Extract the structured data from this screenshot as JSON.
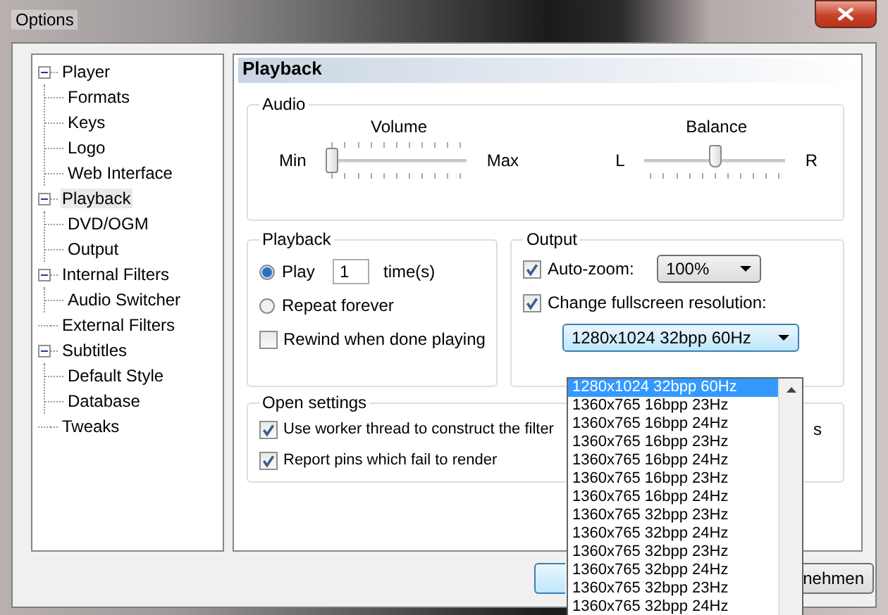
{
  "window": {
    "title": "Options"
  },
  "tree": [
    {
      "label": "Player",
      "selected": false,
      "expanded": true,
      "children": [
        {
          "label": "Formats",
          "selected": false
        },
        {
          "label": "Keys",
          "selected": false
        },
        {
          "label": "Logo",
          "selected": false
        },
        {
          "label": "Web Interface",
          "selected": false
        }
      ]
    },
    {
      "label": "Playback",
      "selected": true,
      "expanded": true,
      "children": [
        {
          "label": "DVD/OGM",
          "selected": false
        },
        {
          "label": "Output",
          "selected": false
        }
      ]
    },
    {
      "label": "Internal Filters",
      "selected": false,
      "expanded": true,
      "children": [
        {
          "label": "Audio Switcher",
          "selected": false
        }
      ]
    },
    {
      "label": "External Filters",
      "selected": false
    },
    {
      "label": "Subtitles",
      "selected": false,
      "expanded": true,
      "children": [
        {
          "label": "Default Style",
          "selected": false
        },
        {
          "label": "Database",
          "selected": false
        }
      ]
    },
    {
      "label": "Tweaks",
      "selected": false
    }
  ],
  "page_title": "Playback",
  "audio": {
    "title": "Audio",
    "sliders": [
      {
        "title": "Volume",
        "min_label": "Min",
        "max_label": "Max",
        "level": 0,
        "ticks_top": true
      },
      {
        "title": "Balance",
        "min_label": "L",
        "max_label": "R",
        "level": 0.5,
        "ticks_top": false
      }
    ]
  },
  "playback": {
    "title": "Playback",
    "radios": [
      {
        "label": "Play",
        "selected": true,
        "count": "1",
        "unit": "time(s)"
      },
      {
        "label": "Repeat forever",
        "selected": false
      }
    ],
    "rewind": {
      "label": "Rewind when done playing",
      "checked": false
    }
  },
  "output": {
    "title": "Output",
    "auto_zoom": {
      "label": "Auto-zoom:",
      "checked": true,
      "value": "100%"
    },
    "fullscreen": {
      "label": "Change fullscreen resolution:",
      "checked": true,
      "value": "1280x1024 32bpp 60Hz"
    },
    "options": [
      {
        "label": "1280x1024 32bpp 60Hz",
        "selected": true
      },
      {
        "label": "1360x765 16bpp 23Hz",
        "selected": false
      },
      {
        "label": "1360x765 16bpp 24Hz",
        "selected": false
      },
      {
        "label": "1360x765 16bpp 23Hz",
        "selected": false
      },
      {
        "label": "1360x765 16bpp 24Hz",
        "selected": false
      },
      {
        "label": "1360x765 16bpp 23Hz",
        "selected": false
      },
      {
        "label": "1360x765 16bpp 24Hz",
        "selected": false
      },
      {
        "label": "1360x765 32bpp 23Hz",
        "selected": false
      },
      {
        "label": "1360x765 32bpp 24Hz",
        "selected": false
      },
      {
        "label": "1360x765 32bpp 23Hz",
        "selected": false
      },
      {
        "label": "1360x765 32bpp 24Hz",
        "selected": false
      },
      {
        "label": "1360x765 32bpp 23Hz",
        "selected": false
      },
      {
        "label": "1360x765 32bpp 24Hz",
        "selected": false
      }
    ]
  },
  "open_settings": {
    "title": "Open settings",
    "checks": [
      {
        "label": "Use worker thread to construct the filter",
        "tail": "s",
        "checked": true
      },
      {
        "label": "Report pins which fail to render",
        "checked": true
      }
    ]
  },
  "buttons": [
    {
      "label": "nehmen"
    }
  ]
}
